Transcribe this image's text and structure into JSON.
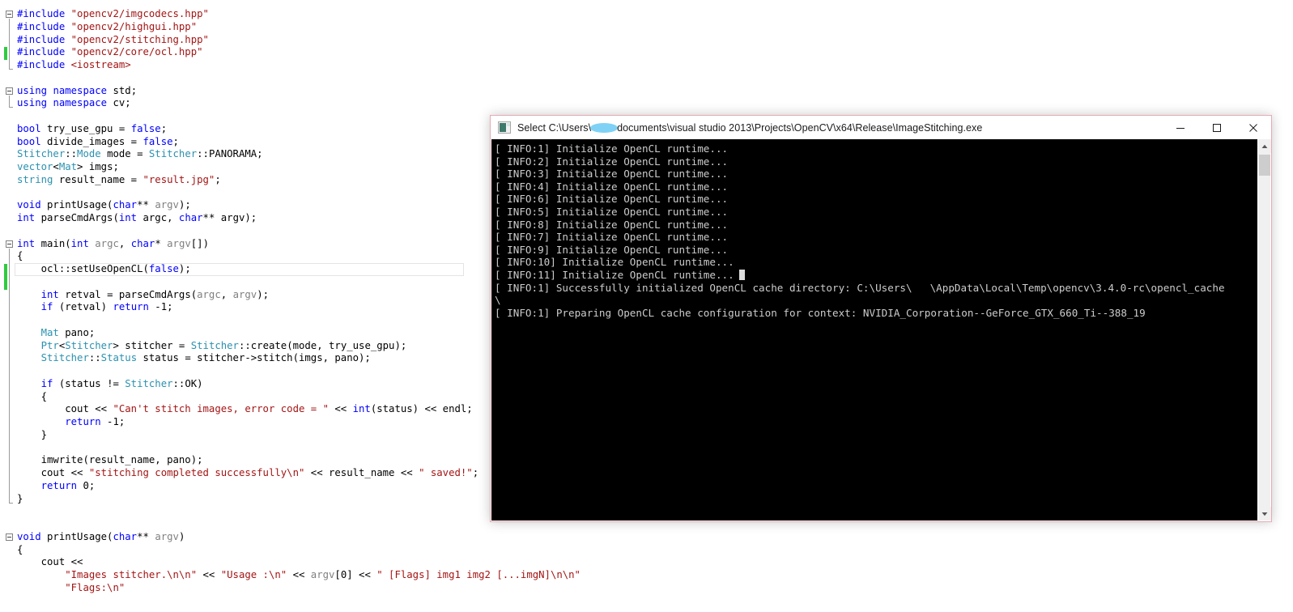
{
  "editor": {
    "name": "visual-studio-code-editor",
    "lines": [
      {
        "indent": 0,
        "fold": "start",
        "tokens": [
          {
            "t": "#include ",
            "c": "ppk"
          },
          {
            "t": "\"opencv2/imgcodecs.hpp\"",
            "c": "str"
          }
        ]
      },
      {
        "indent": 0,
        "tokens": [
          {
            "t": "#include ",
            "c": "ppk"
          },
          {
            "t": "\"opencv2/highgui.hpp\"",
            "c": "str"
          }
        ]
      },
      {
        "indent": 0,
        "tokens": [
          {
            "t": "#include ",
            "c": "ppk"
          },
          {
            "t": "\"opencv2/stitching.hpp\"",
            "c": "str"
          }
        ]
      },
      {
        "indent": 0,
        "tokens": [
          {
            "t": "#include ",
            "c": "ppk"
          },
          {
            "t": "\"opencv2/core/ocl.hpp\"",
            "c": "str"
          }
        ]
      },
      {
        "indent": 0,
        "fold": "end",
        "tokens": [
          {
            "t": "#include ",
            "c": "ppk"
          },
          {
            "t": "<iostream>",
            "c": "str"
          }
        ]
      },
      {
        "indent": 0,
        "tokens": []
      },
      {
        "indent": 0,
        "fold": "start",
        "tokens": [
          {
            "t": "using",
            "c": "kw"
          },
          {
            "t": " ",
            "c": "plain"
          },
          {
            "t": "namespace",
            "c": "kw"
          },
          {
            "t": " std;",
            "c": "plain"
          }
        ]
      },
      {
        "indent": 0,
        "fold": "end",
        "tokens": [
          {
            "t": "using",
            "c": "kw"
          },
          {
            "t": " ",
            "c": "plain"
          },
          {
            "t": "namespace",
            "c": "kw"
          },
          {
            "t": " cv;",
            "c": "plain"
          }
        ]
      },
      {
        "indent": 0,
        "tokens": []
      },
      {
        "indent": 0,
        "tokens": [
          {
            "t": "bool",
            "c": "kw"
          },
          {
            "t": " try_use_gpu = ",
            "c": "plain"
          },
          {
            "t": "false",
            "c": "kw"
          },
          {
            "t": ";",
            "c": "plain"
          }
        ]
      },
      {
        "indent": 0,
        "tokens": [
          {
            "t": "bool",
            "c": "kw"
          },
          {
            "t": " divide_images = ",
            "c": "plain"
          },
          {
            "t": "false",
            "c": "kw"
          },
          {
            "t": ";",
            "c": "plain"
          }
        ]
      },
      {
        "indent": 0,
        "tokens": [
          {
            "t": "Stitcher",
            "c": "typ"
          },
          {
            "t": "::",
            "c": "plain"
          },
          {
            "t": "Mode",
            "c": "typ"
          },
          {
            "t": " mode = ",
            "c": "plain"
          },
          {
            "t": "Stitcher",
            "c": "typ"
          },
          {
            "t": "::PANORAMA;",
            "c": "plain"
          }
        ]
      },
      {
        "indent": 0,
        "tokens": [
          {
            "t": "vector",
            "c": "typ"
          },
          {
            "t": "<",
            "c": "plain"
          },
          {
            "t": "Mat",
            "c": "typ"
          },
          {
            "t": "> imgs;",
            "c": "plain"
          }
        ]
      },
      {
        "indent": 0,
        "tokens": [
          {
            "t": "string",
            "c": "typ"
          },
          {
            "t": " result_name = ",
            "c": "plain"
          },
          {
            "t": "\"result.jpg\"",
            "c": "str"
          },
          {
            "t": ";",
            "c": "plain"
          }
        ]
      },
      {
        "indent": 0,
        "tokens": []
      },
      {
        "indent": 0,
        "tokens": [
          {
            "t": "void",
            "c": "kw"
          },
          {
            "t": " printUsage(",
            "c": "plain"
          },
          {
            "t": "char",
            "c": "kw"
          },
          {
            "t": "** ",
            "c": "plain"
          },
          {
            "t": "argv",
            "c": "id"
          },
          {
            "t": ");",
            "c": "plain"
          }
        ]
      },
      {
        "indent": 0,
        "tokens": [
          {
            "t": "int",
            "c": "kw"
          },
          {
            "t": " parseCmdArgs(",
            "c": "plain"
          },
          {
            "t": "int",
            "c": "kw"
          },
          {
            "t": " argc, ",
            "c": "plain"
          },
          {
            "t": "char",
            "c": "kw"
          },
          {
            "t": "** argv);",
            "c": "plain"
          }
        ]
      },
      {
        "indent": 0,
        "tokens": []
      },
      {
        "indent": 0,
        "fold": "start",
        "tokens": [
          {
            "t": "int",
            "c": "kw"
          },
          {
            "t": " main(",
            "c": "plain"
          },
          {
            "t": "int",
            "c": "kw"
          },
          {
            "t": " ",
            "c": "plain"
          },
          {
            "t": "argc",
            "c": "id"
          },
          {
            "t": ", ",
            "c": "plain"
          },
          {
            "t": "char",
            "c": "kw"
          },
          {
            "t": "* ",
            "c": "plain"
          },
          {
            "t": "argv",
            "c": "id"
          },
          {
            "t": "[])",
            "c": "plain"
          }
        ]
      },
      {
        "indent": 0,
        "tokens": [
          {
            "t": "{",
            "c": "plain"
          }
        ]
      },
      {
        "indent": 1,
        "current": true,
        "tokens": [
          {
            "t": "ocl::setUseOpenCL(",
            "c": "plain"
          },
          {
            "t": "false",
            "c": "kw"
          },
          {
            "t": ");",
            "c": "plain"
          }
        ]
      },
      {
        "indent": 0,
        "tokens": []
      },
      {
        "indent": 1,
        "tokens": [
          {
            "t": "int",
            "c": "kw"
          },
          {
            "t": " retval = parseCmdArgs(",
            "c": "plain"
          },
          {
            "t": "argc",
            "c": "id"
          },
          {
            "t": ", ",
            "c": "plain"
          },
          {
            "t": "argv",
            "c": "id"
          },
          {
            "t": ");",
            "c": "plain"
          }
        ]
      },
      {
        "indent": 1,
        "tokens": [
          {
            "t": "if",
            "c": "kw"
          },
          {
            "t": " (retval) ",
            "c": "plain"
          },
          {
            "t": "return",
            "c": "kw"
          },
          {
            "t": " -1;",
            "c": "plain"
          }
        ]
      },
      {
        "indent": 0,
        "tokens": []
      },
      {
        "indent": 1,
        "tokens": [
          {
            "t": "Mat",
            "c": "typ"
          },
          {
            "t": " pano;",
            "c": "plain"
          }
        ]
      },
      {
        "indent": 1,
        "tokens": [
          {
            "t": "Ptr",
            "c": "typ"
          },
          {
            "t": "<",
            "c": "plain"
          },
          {
            "t": "Stitcher",
            "c": "typ"
          },
          {
            "t": "> stitcher = ",
            "c": "plain"
          },
          {
            "t": "Stitcher",
            "c": "typ"
          },
          {
            "t": "::create(mode, try_use_gpu);",
            "c": "plain"
          }
        ]
      },
      {
        "indent": 1,
        "tokens": [
          {
            "t": "Stitcher",
            "c": "typ"
          },
          {
            "t": "::",
            "c": "plain"
          },
          {
            "t": "Status",
            "c": "typ"
          },
          {
            "t": " status = stitcher->stitch(imgs, pano);",
            "c": "plain"
          }
        ]
      },
      {
        "indent": 0,
        "tokens": []
      },
      {
        "indent": 1,
        "tokens": [
          {
            "t": "if",
            "c": "kw"
          },
          {
            "t": " (status != ",
            "c": "plain"
          },
          {
            "t": "Stitcher",
            "c": "typ"
          },
          {
            "t": "::OK)",
            "c": "plain"
          }
        ]
      },
      {
        "indent": 1,
        "tokens": [
          {
            "t": "{",
            "c": "plain"
          }
        ]
      },
      {
        "indent": 2,
        "tokens": [
          {
            "t": "cout << ",
            "c": "plain"
          },
          {
            "t": "\"Can't stitch images, error code = \"",
            "c": "str"
          },
          {
            "t": " << ",
            "c": "plain"
          },
          {
            "t": "int",
            "c": "kw"
          },
          {
            "t": "(status) << endl;",
            "c": "plain"
          }
        ]
      },
      {
        "indent": 2,
        "tokens": [
          {
            "t": "return",
            "c": "kw"
          },
          {
            "t": " -1;",
            "c": "plain"
          }
        ]
      },
      {
        "indent": 1,
        "tokens": [
          {
            "t": "}",
            "c": "plain"
          }
        ]
      },
      {
        "indent": 0,
        "tokens": []
      },
      {
        "indent": 1,
        "tokens": [
          {
            "t": "imwrite(result_name, pano);",
            "c": "plain"
          }
        ]
      },
      {
        "indent": 1,
        "tokens": [
          {
            "t": "cout << ",
            "c": "plain"
          },
          {
            "t": "\"stitching completed successfully\\n\"",
            "c": "str"
          },
          {
            "t": " << result_name << ",
            "c": "plain"
          },
          {
            "t": "\" saved!\"",
            "c": "str"
          },
          {
            "t": ";",
            "c": "plain"
          }
        ]
      },
      {
        "indent": 1,
        "tokens": [
          {
            "t": "return",
            "c": "kw"
          },
          {
            "t": " 0;",
            "c": "plain"
          }
        ]
      },
      {
        "indent": 0,
        "fold": "end",
        "tokens": [
          {
            "t": "}",
            "c": "plain"
          }
        ]
      },
      {
        "indent": 0,
        "tokens": []
      },
      {
        "indent": 0,
        "tokens": []
      },
      {
        "indent": 0,
        "fold": "start",
        "tokens": [
          {
            "t": "void",
            "c": "kw"
          },
          {
            "t": " printUsage(",
            "c": "plain"
          },
          {
            "t": "char",
            "c": "kw"
          },
          {
            "t": "** ",
            "c": "plain"
          },
          {
            "t": "argv",
            "c": "id"
          },
          {
            "t": ")",
            "c": "plain"
          }
        ]
      },
      {
        "indent": 0,
        "tokens": [
          {
            "t": "{",
            "c": "plain"
          }
        ]
      },
      {
        "indent": 1,
        "tokens": [
          {
            "t": "cout <<",
            "c": "plain"
          }
        ]
      },
      {
        "indent": 2,
        "tokens": [
          {
            "t": "\"Images stitcher.\\n\\n\"",
            "c": "str"
          },
          {
            "t": " << ",
            "c": "plain"
          },
          {
            "t": "\"Usage :\\n\"",
            "c": "str"
          },
          {
            "t": " << ",
            "c": "plain"
          },
          {
            "t": "argv",
            "c": "id"
          },
          {
            "t": "[0] << ",
            "c": "plain"
          },
          {
            "t": "\" [Flags] img1 img2 [...imgN]\\n\\n\"",
            "c": "str"
          }
        ]
      },
      {
        "indent": 2,
        "tokens": [
          {
            "t": "\"Flags:\\n\"",
            "c": "str"
          }
        ]
      }
    ]
  },
  "console": {
    "name": "image-stitching-console",
    "title_prefix": "Select C:\\Users\\",
    "title_suffix": "documents\\visual studio 2013\\Projects\\OpenCV\\x64\\Release\\ImageStitching.exe",
    "icon": "console-icon",
    "window_buttons": {
      "minimize": "minimize",
      "maximize": "maximize",
      "close": "close"
    },
    "border_color": "#e8aab4",
    "background_color": "#000000",
    "text_color": "#cccccc",
    "lines": [
      {
        "pre": "[ INFO:1] Initialize OpenCL runtime..."
      },
      {
        "pre": "[ INFO:2] Initialize OpenCL runtime..."
      },
      {
        "pre": "[ INFO:3] Initialize OpenCL runtime..."
      },
      {
        "pre": "[ INFO:4] Initialize OpenCL runtime..."
      },
      {
        "pre": "[ INFO:6] Initialize OpenCL runtime..."
      },
      {
        "pre": "[ INFO:5] Initialize OpenCL runtime..."
      },
      {
        "pre": "[ INFO:8] Initialize OpenCL runtime..."
      },
      {
        "pre": "[ INFO:7] Initialize OpenCL runtime..."
      },
      {
        "pre": "[ INFO:9] Initialize OpenCL runtime..."
      },
      {
        "pre": "[ INFO:10] Initialize OpenCL runtime..."
      },
      {
        "pre": "[ INFO:11] Initialize OpenCL runtime...",
        "caret": true
      },
      {
        "pre": "[ INFO:1] Successfully initialized OpenCL cache directory: C:\\Users\\",
        "redact": true,
        "post": "\\AppData\\Local\\Temp\\opencv\\3.4.0-rc\\opencl_cache"
      },
      {
        "pre": "\\"
      },
      {
        "pre": "[ INFO:1] Preparing OpenCL cache configuration for context: NVIDIA_Corporation--GeForce_GTX_660_Ti--388_19"
      }
    ],
    "scrollbar": {
      "up_arrow": "▲",
      "down_arrow": "▼"
    }
  }
}
